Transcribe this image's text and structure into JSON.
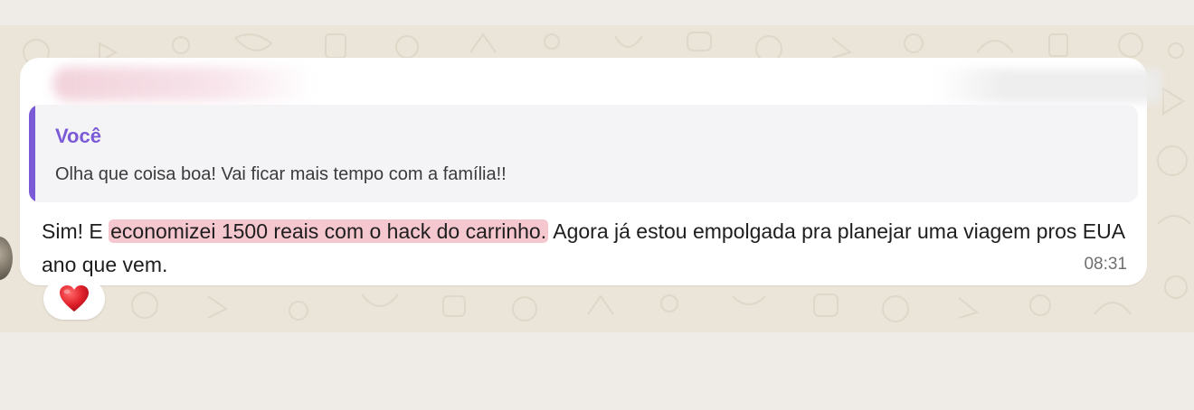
{
  "message": {
    "quote": {
      "author": "Você",
      "text": "Olha que coisa boa! Vai ficar mais tempo com a família!!"
    },
    "text_before": "Sim! E ",
    "text_highlight": "economizei 1500 reais com o hack do carrinho.",
    "text_after": " Agora já estou empolgada pra planejar uma viagem pros EUA ano que vem.",
    "time": "08:31",
    "reaction": "heart-emoji"
  },
  "colors": {
    "quote_accent": "#7a5ad6",
    "highlight": "#f5c7cf",
    "chat_background": "#ebe4d8",
    "bubble": "#ffffff"
  }
}
